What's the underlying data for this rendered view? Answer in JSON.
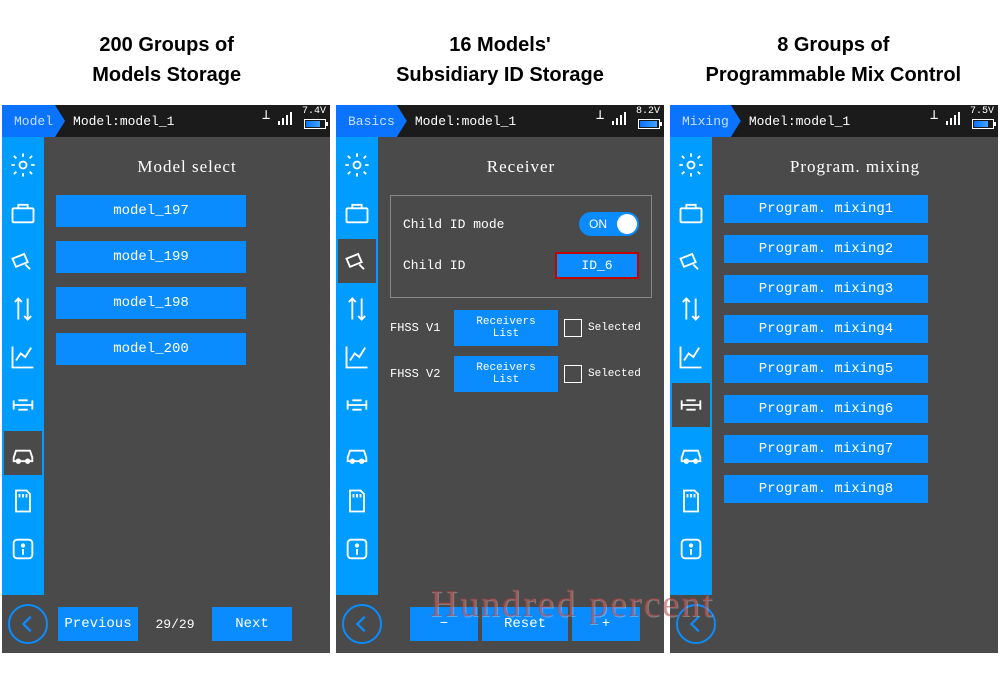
{
  "titles": {
    "t1a": "200 Groups of",
    "t1b": "Models Storage",
    "t2a": "16 Models'",
    "t2b": "Subsidiary ID Storage",
    "t3a": "8 Groups of",
    "t3b": "Programmable Mix Control"
  },
  "screen1": {
    "crumb": "Model",
    "model": "Model:model_1",
    "voltage": "7.4V",
    "section": "Model select",
    "items": [
      "model_197",
      "model_199",
      "model_198",
      "model_200"
    ],
    "prev": "Previous",
    "page": "29/29",
    "next": "Next"
  },
  "screen2": {
    "crumb": "Basics",
    "model": "Model:model_1",
    "voltage": "8.2V",
    "section": "Receiver",
    "child_mode_label": "Child ID mode",
    "child_mode_on": "ON",
    "child_id_label": "Child ID",
    "child_id_value": "ID_6",
    "fhss": [
      {
        "label": "FHSS V1",
        "btn": "Receivers List",
        "sel": "Selected"
      },
      {
        "label": "FHSS V2",
        "btn": "Receivers List",
        "sel": "Selected"
      }
    ],
    "minus": "−",
    "reset": "Reset",
    "plus": "+"
  },
  "screen3": {
    "crumb": "Mixing",
    "model": "Model:model_1",
    "voltage": "7.5V",
    "section": "Program. mixing",
    "items": [
      "Program. mixing1",
      "Program. mixing2",
      "Program. mixing3",
      "Program. mixing4",
      "Program. mixing5",
      "Program. mixing6",
      "Program. mixing7",
      "Program. mixing8"
    ]
  },
  "watermark": "Hundred percent"
}
